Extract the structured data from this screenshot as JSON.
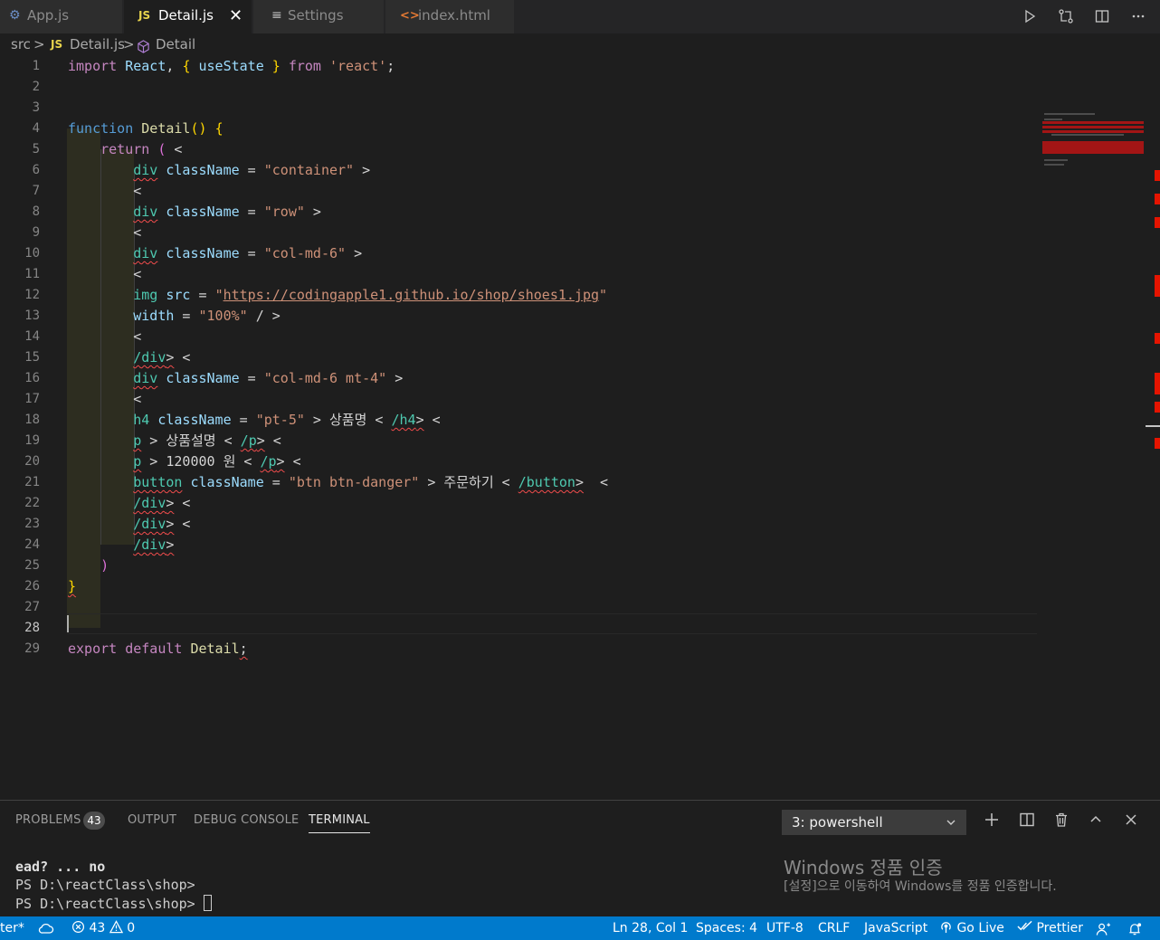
{
  "tabs": [
    {
      "label": "App.js",
      "icon": "gear-icon",
      "active": false
    },
    {
      "label": "Detail.js",
      "icon": "js-icon",
      "icon_text": "JS",
      "active": true,
      "close": "✕"
    },
    {
      "label": "Settings",
      "icon": "settings-list-icon",
      "active": false
    },
    {
      "label": "index.html",
      "icon": "html-chevrons-icon",
      "active": false
    }
  ],
  "tab_actions": [
    "run-icon",
    "compare-changes-icon",
    "split-editor-icon",
    "more-actions-icon"
  ],
  "breadcrumb": {
    "folder": "src",
    "sep": ">",
    "file_icon": "JS",
    "file": "Detail.js",
    "symbol": "Detail"
  },
  "editor": {
    "line_numbers": [
      "1",
      "2",
      "3",
      "4",
      "5",
      "6",
      "7",
      "8",
      "9",
      "10",
      "11",
      "12",
      "13",
      "14",
      "15",
      "16",
      "17",
      "18",
      "19",
      "20",
      "21",
      "22",
      "23",
      "24",
      "25",
      "26",
      "27",
      "28",
      "29"
    ],
    "current_line": 28
  },
  "panel": {
    "tabs": [
      "PROBLEMS",
      "OUTPUT",
      "DEBUG CONSOLE",
      "TERMINAL"
    ],
    "active_tab": "TERMINAL",
    "problems_count": "43",
    "terminal_select": "3: powershell",
    "terminal_lines": [
      "ead? ... no",
      "PS D:\\reactClass\\shop>",
      "PS D:\\reactClass\\shop> "
    ],
    "activation_title": "Windows 정품 인증",
    "activation_sub": "[설정]으로 이동하여 Windows를 정품 인증합니다."
  },
  "status": {
    "left_cut": "ter*",
    "errors": "43",
    "warnings": "0",
    "position": "Ln 28, Col 1",
    "spaces": "Spaces: 4",
    "encoding": "UTF-8",
    "eol": "CRLF",
    "language": "JavaScript",
    "golive": "Go Live",
    "prettier": "Prettier"
  },
  "colors": {
    "editor_bg": "#1e1e1e",
    "status_bg": "#007acc",
    "keyword": "#c586c0",
    "tag": "#4ec9b0",
    "string": "#ce9178",
    "error": "#f14c4c"
  }
}
